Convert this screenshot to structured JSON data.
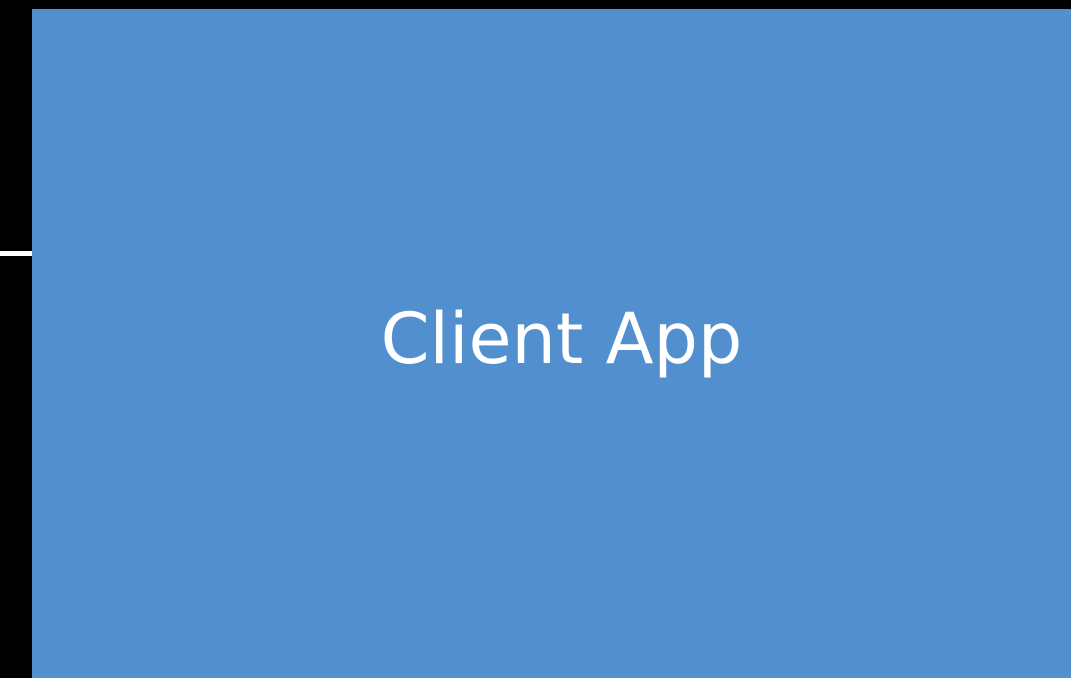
{
  "diagram": {
    "client_box": {
      "label": "Client App",
      "fill_color": "#528fce",
      "text_color": "#ffffff"
    },
    "connector": {
      "color": "#ffffff"
    },
    "background_color": "#000000"
  }
}
